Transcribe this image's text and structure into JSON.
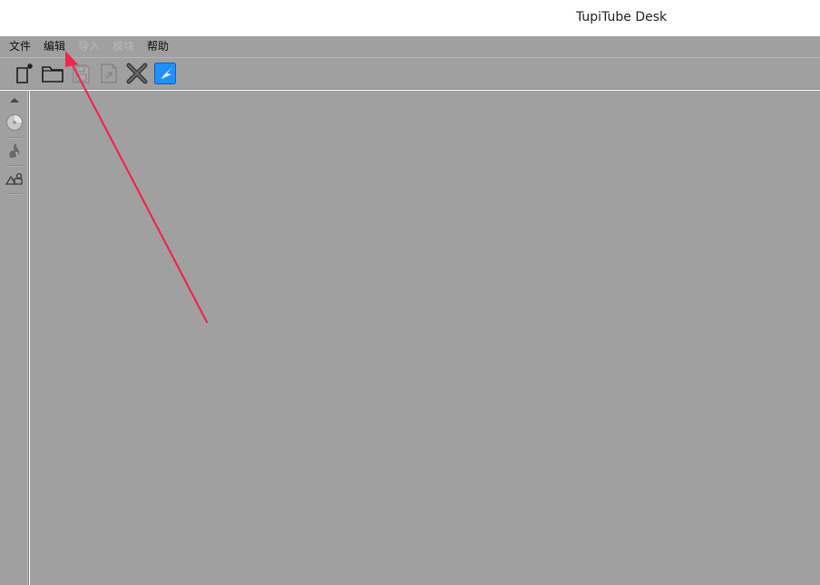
{
  "window": {
    "title": "TupiTube Desk"
  },
  "menubar": {
    "items": [
      {
        "label": "文件",
        "enabled": true
      },
      {
        "label": "编辑",
        "enabled": true
      },
      {
        "label": "导入",
        "enabled": false
      },
      {
        "label": "模块",
        "enabled": false
      },
      {
        "label": "帮助",
        "enabled": true
      }
    ]
  },
  "toolbar": {
    "buttons": [
      {
        "icon": "new-document-icon",
        "enabled": true
      },
      {
        "icon": "open-folder-icon",
        "enabled": true
      },
      {
        "icon": "save-icon",
        "enabled": false
      },
      {
        "icon": "save-as-icon",
        "enabled": false
      },
      {
        "icon": "close-x-icon",
        "enabled": true
      },
      {
        "icon": "tupitube-logo-icon",
        "enabled": true
      }
    ]
  },
  "sidebar": {
    "buttons": [
      {
        "icon": "disc-icon",
        "enabled": false
      },
      {
        "icon": "bird-icon",
        "enabled": false
      },
      {
        "icon": "shapes-icon",
        "enabled": false
      }
    ]
  },
  "colors": {
    "panel": "#a0a0a0",
    "annotation_arrow": "#f0264e",
    "tupi_logo": "#1e90ff"
  }
}
